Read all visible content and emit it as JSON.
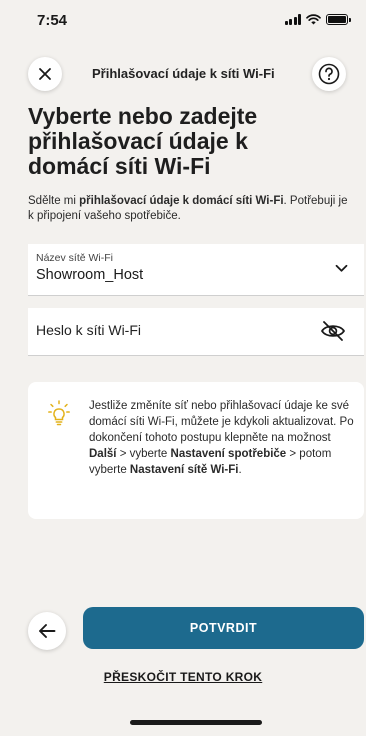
{
  "status_bar": {
    "time": "7:54",
    "icons": [
      "signal-icon",
      "wifi-icon",
      "battery-icon"
    ]
  },
  "header": {
    "title": "Přihlašovací údaje k síti Wi-Fi",
    "close_icon": "close-icon",
    "help_icon": "help-icon"
  },
  "heading": "Vyberte nebo zadejte přihlašovací údaje k domácí síti Wi-Fi",
  "subtext": {
    "part1": "Sdělte mi ",
    "bold": "přihlašovací údaje k domácí síti Wi-Fi",
    "part2": ". Potřebuji je k připojení vašeho spotřebiče."
  },
  "ssid_field": {
    "label": "Název sítě Wi-Fi",
    "value": "Showroom_Host",
    "icon": "chevron-down-icon"
  },
  "password_field": {
    "placeholder": "Heslo k síti Wi-Fi",
    "icon": "eye-off-icon"
  },
  "info": {
    "icon": "lightbulb-icon",
    "t1": "Jestliže změníte síť nebo přihlašovací údaje ke své domácí síti Wi-Fi, můžete je kdykoli aktualizovat. Po dokončení tohoto postupu klepněte na možnost ",
    "b1": "Další",
    "t2": " > vyberte ",
    "b2": "Nastavení spotřebiče",
    "t3": " > potom vyberte ",
    "b3": "Nastavení sítě Wi-Fi",
    "t4": "."
  },
  "actions": {
    "back_icon": "arrow-left-icon",
    "confirm_label": "POTVRDIT",
    "skip_label": "PŘESKOČIT TENTO KROK"
  },
  "colors": {
    "background": "#f3f1ee",
    "primary": "#1d6a8e",
    "bulb": "#e3b21b"
  }
}
